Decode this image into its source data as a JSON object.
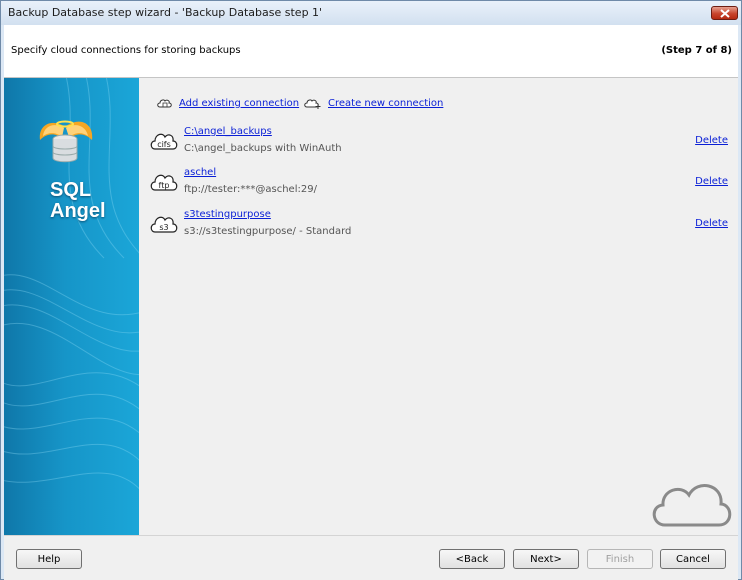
{
  "window": {
    "title": "Backup Database step wizard - 'Backup Database step 1'"
  },
  "header": {
    "subtitle": "Specify cloud connections for storing backups",
    "step": "(Step 7 of 8)"
  },
  "sidebar": {
    "logo_line1": "SQL",
    "logo_line2": "Angel"
  },
  "actions": {
    "add_existing": "Add existing connection",
    "create_new": "Create new connection"
  },
  "connections": [
    {
      "type": "cifs",
      "name": "C:\\angel_backups",
      "description": "C:\\angel_backups with WinAuth",
      "delete_label": "Delete"
    },
    {
      "type": "ftp",
      "name": "aschel",
      "description": "ftp://tester:***@aschel:29/",
      "delete_label": "Delete"
    },
    {
      "type": "s3",
      "name": "s3testingpurpose",
      "description": "s3://s3testingpurpose/ - Standard",
      "delete_label": "Delete"
    }
  ],
  "footer": {
    "help": "Help",
    "back": "<Back",
    "next": "Next>",
    "finish": "Finish",
    "cancel": "Cancel"
  },
  "colors": {
    "link": "#0a1fd6",
    "sidebar": "#1695c8",
    "close": "#c8452d"
  }
}
